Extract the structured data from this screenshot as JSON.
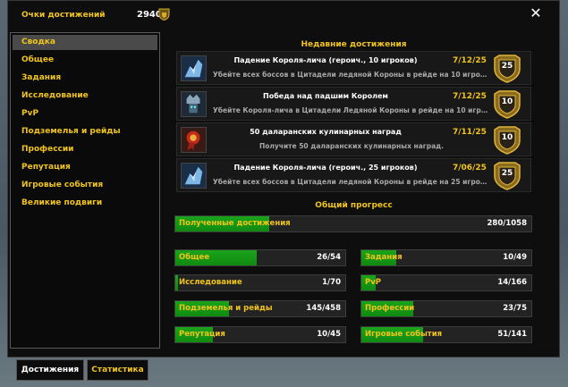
{
  "header": {
    "label": "Очки достижений",
    "points": "2940"
  },
  "sidebar": {
    "items": [
      {
        "label": "Сводка"
      },
      {
        "label": "Общее"
      },
      {
        "label": "Задания"
      },
      {
        "label": "Исследование"
      },
      {
        "label": "PvP"
      },
      {
        "label": "Подземелья и рейды"
      },
      {
        "label": "Профессии"
      },
      {
        "label": "Репутация"
      },
      {
        "label": "Игровые события"
      },
      {
        "label": "Великие подвиги"
      }
    ]
  },
  "recent": {
    "title": "Недавние достижения",
    "items": [
      {
        "title": "Падение Короля-лича (героич., 10 игроков)",
        "date": "7/12/25",
        "desc": "Убейте всех боссов в Цитадели ледяной Короны в рейде на 10 игроков в гер...",
        "points": "25",
        "icon": "frost-boss-icon"
      },
      {
        "title": "Победа над падшим Королем",
        "date": "7/12/25",
        "desc": "Убейте Короля-лича в Цитадели Ледяной Короны в рейде на 10 игроков в гер...",
        "points": "10",
        "icon": "lich-king-icon"
      },
      {
        "title": "50 даларанских кулинарных наград",
        "date": "7/11/25",
        "desc": "Получите 50 даларанских кулинарных наград.",
        "points": "10",
        "icon": "cooking-award-icon"
      },
      {
        "title": "Падение Короля-лича (героич., 25 игроков)",
        "date": "7/06/25",
        "desc": "Убейте всех боссов в Цитадели ледяной Короны в рейде на 25 игроков в гер...",
        "points": "25",
        "icon": "frost-boss-icon"
      }
    ]
  },
  "progress": {
    "title": "Общий прогресс",
    "total": {
      "label": "Полученные достижения",
      "value": "280/1058",
      "fraction": 0.265
    },
    "categories": [
      {
        "label": "Общее",
        "value": "26/54",
        "fraction": 0.481
      },
      {
        "label": "Задания",
        "value": "10/49",
        "fraction": 0.204
      },
      {
        "label": "Исследование",
        "value": "1/70",
        "fraction": 0.014
      },
      {
        "label": "PvP",
        "value": "14/166",
        "fraction": 0.084
      },
      {
        "label": "Подземелья и рейды",
        "value": "145/458",
        "fraction": 0.317
      },
      {
        "label": "Профессии",
        "value": "23/75",
        "fraction": 0.307
      },
      {
        "label": "Репутация",
        "value": "10/45",
        "fraction": 0.222
      },
      {
        "label": "Игровые события",
        "value": "51/141",
        "fraction": 0.362
      }
    ]
  },
  "tabs": [
    {
      "label": "Достижения"
    },
    {
      "label": "Статистика"
    }
  ],
  "colors": {
    "gold": "#f0c419",
    "bar_green": "#1aa41a",
    "background": "#0e0e0e"
  }
}
